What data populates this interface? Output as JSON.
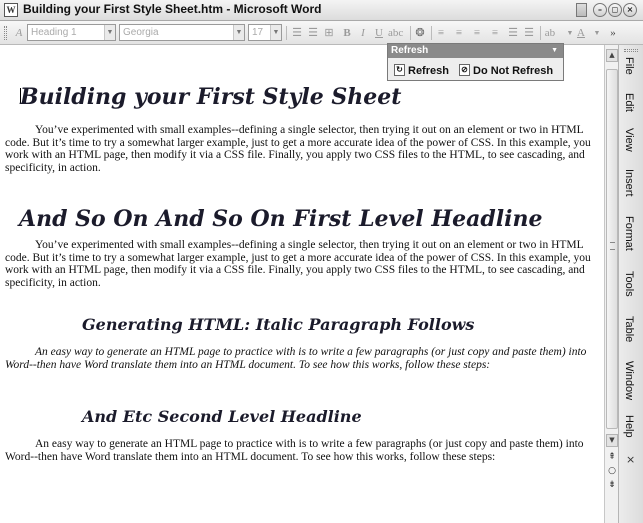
{
  "window": {
    "title": "Building your First Style Sheet.htm - Microsoft Word",
    "app_icon": "word-doc-icon",
    "controls": {
      "minimize": "–",
      "restore": "◻",
      "close": "×"
    }
  },
  "toolbar": {
    "style": "Heading 1",
    "font": "Georgia",
    "size": "17",
    "bold": "B",
    "italic": "I",
    "underline": "U"
  },
  "refresh_toolbar": {
    "title": "Refresh",
    "refresh_label": "Refresh",
    "do_not_refresh_label": "Do Not Refresh"
  },
  "document": {
    "heading1": "Building your First Style Sheet",
    "para1": "You’ve experimented with small examples--defining a single selector, then trying it out on an element or two in HTML code. But it’s time to try a somewhat larger example, just to get a more accurate idea of the power of CSS. In this example, you work with an HTML page, then modify it via a CSS file. Finally, you apply two CSS files to the HTML, to see cascading, and specificity, in action.",
    "heading_first_level": "And So On And So On First Level Headline",
    "para2": "You’ve experimented with small examples--defining a single selector, then trying it out on an element or two in HTML code. But it’s time to try a somewhat larger example, just to get a more accurate idea of the power of CSS. In this example, you work with an HTML page, then modify it via a CSS file. Finally, you apply two CSS files to the HTML, to see cascading, and specificity, in action.",
    "heading_italic": "Generating HTML: Italic Paragraph Follows",
    "para3": "An easy way to generate an HTML page to practice with is to write a few paragraphs (or just copy and paste them) into Word--then have Word translate them into an HTML document. To see how this works, follow these steps:",
    "heading_second_level": "And Etc Second Level Headline",
    "para4": "An easy way to generate an HTML page to practice with is to write a few paragraphs (or just copy and paste them) into Word--then have Word translate them into an HTML document. To see how this works, follow these steps:"
  },
  "menu": {
    "items": [
      "File",
      "Edit",
      "View",
      "Insert",
      "Format",
      "Tools",
      "Table",
      "Window",
      "Help"
    ],
    "close": "×"
  }
}
